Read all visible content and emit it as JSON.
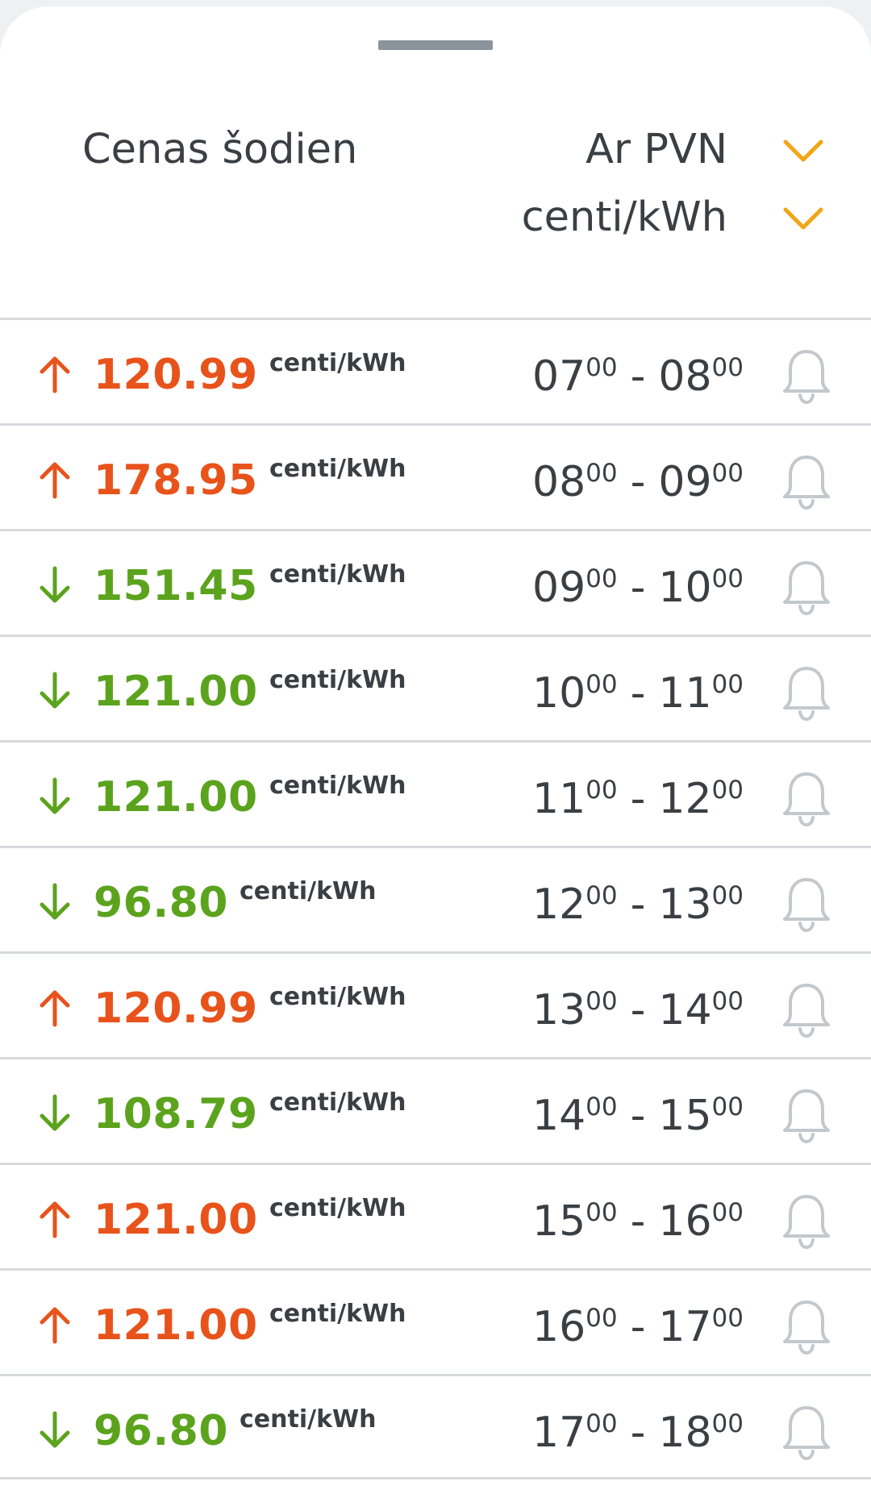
{
  "header": {
    "title": "Cenas šodien",
    "vat_dropdown": {
      "label": "Ar PVN"
    },
    "unit_dropdown": {
      "label": "centi/kWh"
    }
  },
  "colors": {
    "up": "#e8531b",
    "down": "#5ba31d",
    "accent": "#f2a516",
    "text": "#3a3f44",
    "bell": "#c3c8cc"
  },
  "rows": [
    {
      "trend": "up",
      "price": "120.99",
      "unit": "centi/kWh",
      "from_h": "07",
      "from_m": "00",
      "to_h": "08",
      "to_m": "00"
    },
    {
      "trend": "up",
      "price": "178.95",
      "unit": "centi/kWh",
      "from_h": "08",
      "from_m": "00",
      "to_h": "09",
      "to_m": "00"
    },
    {
      "trend": "down",
      "price": "151.45",
      "unit": "centi/kWh",
      "from_h": "09",
      "from_m": "00",
      "to_h": "10",
      "to_m": "00"
    },
    {
      "trend": "down",
      "price": "121.00",
      "unit": "centi/kWh",
      "from_h": "10",
      "from_m": "00",
      "to_h": "11",
      "to_m": "00"
    },
    {
      "trend": "down",
      "price": "121.00",
      "unit": "centi/kWh",
      "from_h": "11",
      "from_m": "00",
      "to_h": "12",
      "to_m": "00"
    },
    {
      "trend": "down",
      "price": "96.80",
      "unit": "centi/kWh",
      "from_h": "12",
      "from_m": "00",
      "to_h": "13",
      "to_m": "00"
    },
    {
      "trend": "up",
      "price": "120.99",
      "unit": "centi/kWh",
      "from_h": "13",
      "from_m": "00",
      "to_h": "14",
      "to_m": "00"
    },
    {
      "trend": "down",
      "price": "108.79",
      "unit": "centi/kWh",
      "from_h": "14",
      "from_m": "00",
      "to_h": "15",
      "to_m": "00"
    },
    {
      "trend": "up",
      "price": "121.00",
      "unit": "centi/kWh",
      "from_h": "15",
      "from_m": "00",
      "to_h": "16",
      "to_m": "00"
    },
    {
      "trend": "up",
      "price": "121.00",
      "unit": "centi/kWh",
      "from_h": "16",
      "from_m": "00",
      "to_h": "17",
      "to_m": "00"
    },
    {
      "trend": "down",
      "price": "96.80",
      "unit": "centi/kWh",
      "from_h": "17",
      "from_m": "00",
      "to_h": "18",
      "to_m": "00"
    }
  ]
}
